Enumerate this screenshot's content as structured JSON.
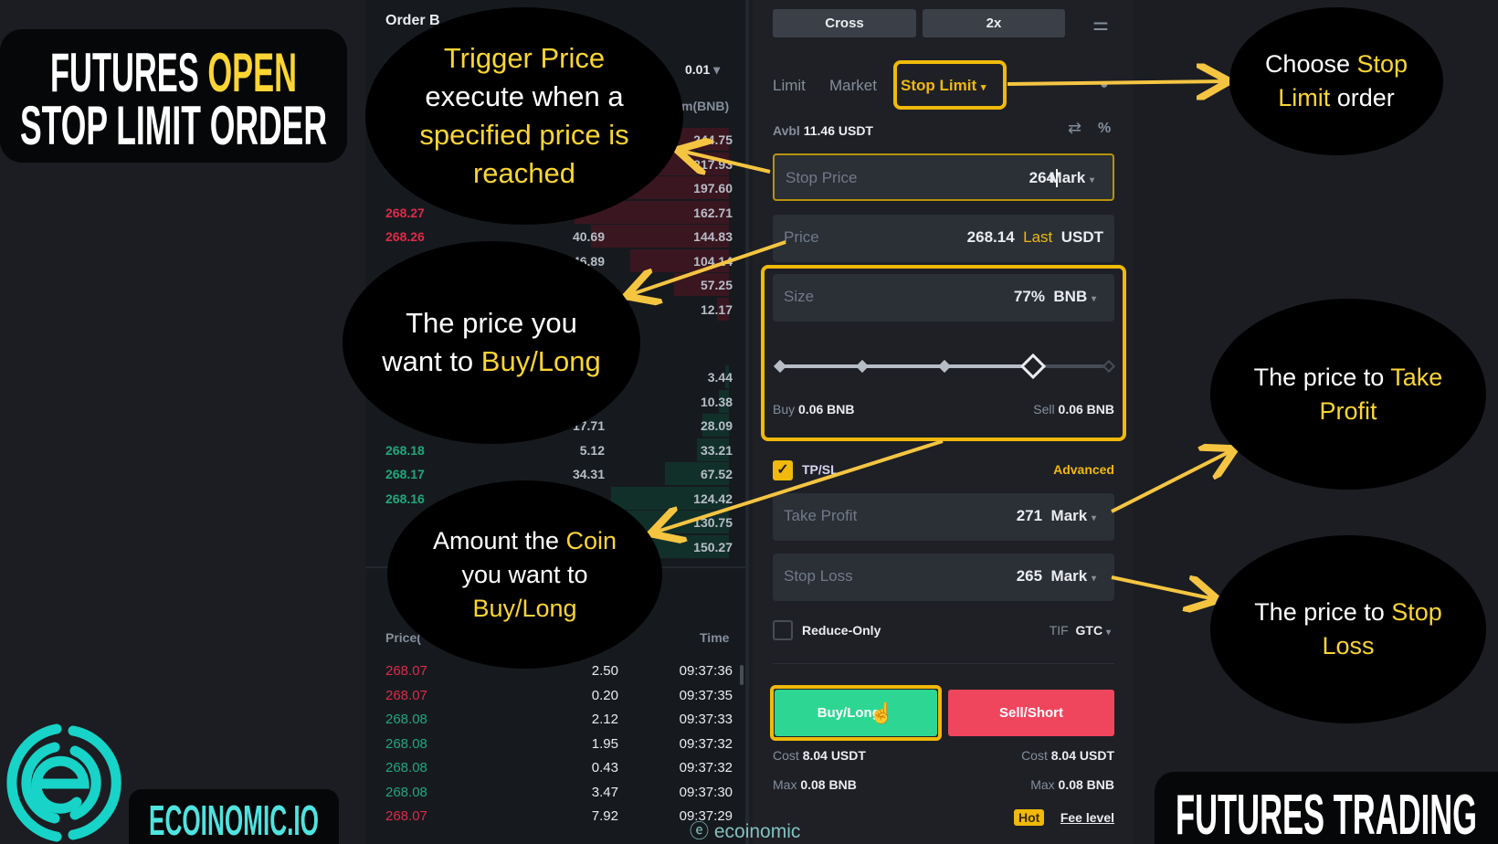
{
  "title": {
    "line1_white": "FUTURES ",
    "line1_yellow": "OPEN",
    "line2": "STOP LIMIT ORDER"
  },
  "brand": {
    "name": "ECOINOMIC.IO",
    "watermark": "ecoinomic",
    "footer": "FUTURES TRADING"
  },
  "orderbook": {
    "title": "Order B",
    "precision": "0.01",
    "sum_header": "m(BNB)",
    "asks": [
      {
        "price": "",
        "amount": "",
        "sum": "244.75"
      },
      {
        "price": "",
        "amount": "",
        "sum": "217.93"
      },
      {
        "price": "",
        "amount": "",
        "sum": "197.60"
      },
      {
        "price": "268.27",
        "amount": "",
        "sum": "162.71"
      },
      {
        "price": "268.26",
        "amount": "40.69",
        "sum": "144.83"
      },
      {
        "price": "",
        "amount": "46.89",
        "sum": "104.14"
      },
      {
        "price": "",
        "amount": "",
        "sum": "57.25"
      },
      {
        "price": "",
        "amount": "",
        "sum": "12.17"
      }
    ],
    "bids": [
      {
        "price": "",
        "amount": "",
        "sum": "3.44"
      },
      {
        "price": "",
        "amount": "",
        "sum": "10.38"
      },
      {
        "price": "",
        "amount": "17.71",
        "sum": "28.09"
      },
      {
        "price": "268.18",
        "amount": "5.12",
        "sum": "33.21"
      },
      {
        "price": "268.17",
        "amount": "34.31",
        "sum": "67.52"
      },
      {
        "price": "268.16",
        "amount": "",
        "sum": "124.42"
      },
      {
        "price": "",
        "amount": "",
        "sum": "130.75"
      },
      {
        "price": "",
        "amount": "",
        "sum": "150.27"
      }
    ]
  },
  "trades": {
    "price_header": "Price(",
    "time_header": "Time",
    "rows": [
      {
        "price": "268.07",
        "qty": "2.50",
        "time": "09:37:36",
        "side": "sell"
      },
      {
        "price": "268.07",
        "qty": "0.20",
        "time": "09:37:35",
        "side": "sell"
      },
      {
        "price": "268.08",
        "qty": "2.12",
        "time": "09:37:33",
        "side": "buy"
      },
      {
        "price": "268.08",
        "qty": "1.95",
        "time": "09:37:32",
        "side": "buy"
      },
      {
        "price": "268.08",
        "qty": "0.43",
        "time": "09:37:32",
        "side": "buy"
      },
      {
        "price": "268.08",
        "qty": "3.47",
        "time": "09:37:30",
        "side": "buy"
      },
      {
        "price": "268.07",
        "qty": "7.92",
        "time": "09:37:29",
        "side": "sell"
      }
    ]
  },
  "form": {
    "margin_mode": "Cross",
    "leverage": "2x",
    "tabs": [
      "Limit",
      "Market",
      "Stop Limit"
    ],
    "active_tab": "Stop Limit",
    "avbl_label": "Avbl",
    "avbl_value": "11.46 USDT",
    "stop_price": {
      "label": "Stop Price",
      "value": "264",
      "unit": "Mark"
    },
    "price": {
      "label": "Price",
      "value": "268.14",
      "tag": "Last",
      "unit": "USDT"
    },
    "size": {
      "label": "Size",
      "value": "77%",
      "unit": "BNB",
      "slider_percent": 77
    },
    "buy_qty_label": "Buy",
    "buy_qty": "0.06 BNB",
    "sell_qty_label": "Sell",
    "sell_qty": "0.06 BNB",
    "tpsl_label": "TP/SL",
    "tpsl_checked": true,
    "advanced": "Advanced",
    "take_profit": {
      "label": "Take Profit",
      "value": "271",
      "unit": "Mark"
    },
    "stop_loss": {
      "label": "Stop Loss",
      "value": "265",
      "unit": "Mark"
    },
    "reduce_only": "Reduce-Only",
    "tif_label": "TIF",
    "tif_value": "GTC",
    "buy_button": "Buy/Long",
    "sell_button": "Sell/Short",
    "cost_label": "Cost",
    "buy_cost": "8.04 USDT",
    "sell_cost": "8.04 USDT",
    "max_label": "Max",
    "buy_max": "0.08 BNB",
    "sell_max": "0.08 BNB",
    "hot": "Hot",
    "fee_level": "Fee level"
  },
  "callouts": {
    "trigger": {
      "a": "Trigger Price",
      "b": "execute when a",
      "c": "specified price is",
      "d": "reached"
    },
    "price": {
      "a": "The price you",
      "b": "want to ",
      "c": "Buy/Long"
    },
    "amount": {
      "a": "Amount the ",
      "b": "Coin",
      "c": "you want to",
      "d": "Buy/Long"
    },
    "choose": {
      "a": "Choose ",
      "b": "Stop",
      "c": "Limit",
      "d": " order"
    },
    "tp": {
      "a": "The price to ",
      "b": "Take",
      "c": "Profit"
    },
    "sl": {
      "a": "The price to ",
      "b": "Stop",
      "c": "Loss"
    }
  },
  "colors": {
    "accent": "#fcd535",
    "buy": "#2ebd85",
    "sell": "#f6465d",
    "brand": "#17d3c8"
  }
}
